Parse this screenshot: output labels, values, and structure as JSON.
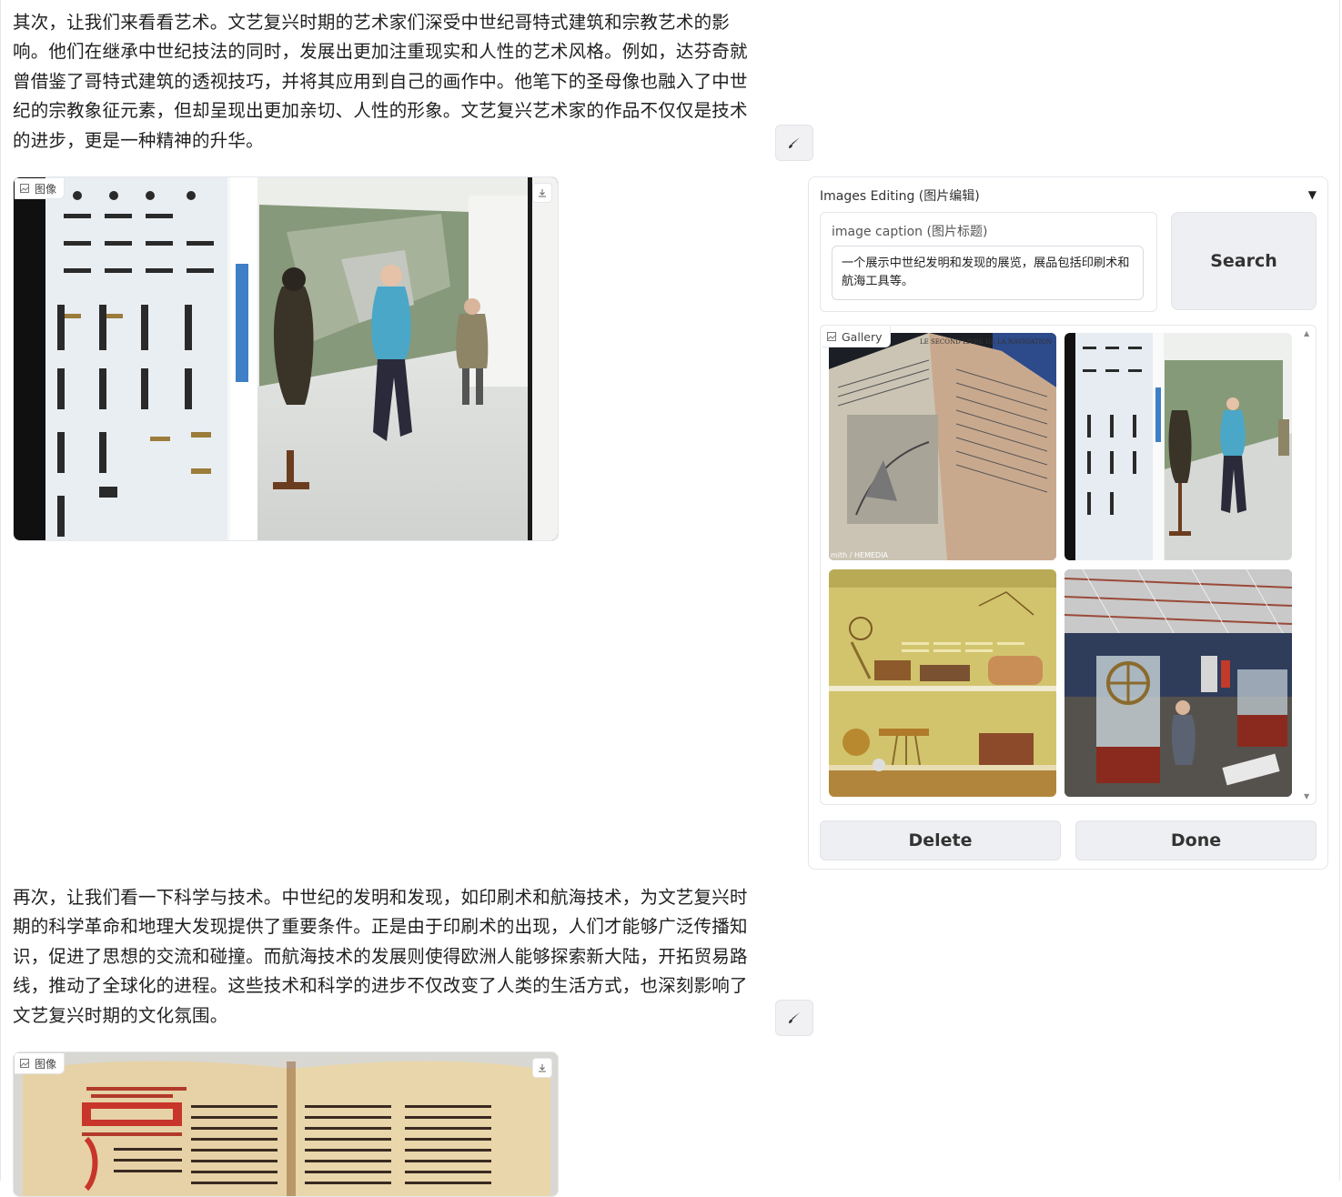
{
  "section_art": {
    "text": "其次，让我们来看看艺术。文艺复兴时期的艺术家们深受中世纪哥特式建筑和宗教艺术的影响。他们在继承中世纪技法的同时，发展出更加注重现实和人性的艺术风格。例如，达芬奇就曾借鉴了哥特式建筑的透视技巧，并将其应用到自己的画作中。他笔下的圣母像也融入了中世纪的宗教象征元素，但却呈现出更加亲切、人性的形象。文艺复兴艺术家的作品不仅仅是技术的进步，更是一种精神的升华。",
    "image_label": "图像"
  },
  "section_science": {
    "text": "再次，让我们看一下科学与技术。中世纪的发明和发现，如印刷术和航海技术，为文艺复兴时期的科学革命和地理大发现提供了重要条件。正是由于印刷术的出现，人们才能够广泛传播知识，促进了思想的交流和碰撞。而航海技术的发展则使得欧洲人能够探索新大陆，开拓贸易路线，推动了全球化的进程。这些技术和科学的进步不仅改变了人类的生活方式，也深刻影响了文艺复兴时期的文化氛围。",
    "image_label": "图像"
  },
  "editor": {
    "title": "Images Editing (图片编辑)",
    "caption_label": "image caption (图片标题)",
    "caption_value": "一个展示中世纪发明和发现的展览，展品包括印刷术和航海工具等。",
    "search_label": "Search",
    "gallery_label": "Gallery",
    "delete_label": "Delete",
    "done_label": "Done",
    "thumb1_credit": "mith / HEMEDIA",
    "thumb1_book_title": "LE SECOND LIVRE DE LA NAVIGATION"
  },
  "colors": {
    "button_bg": "#eeeff2",
    "border": "#e5e7eb"
  }
}
